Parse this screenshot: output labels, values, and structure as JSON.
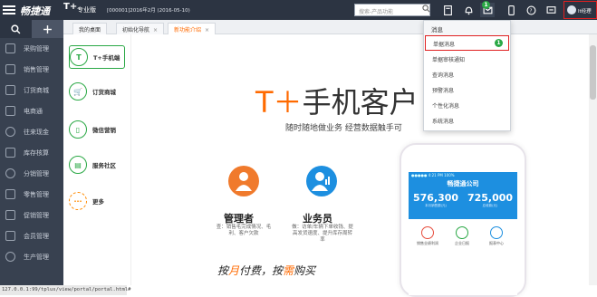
{
  "app": {
    "brand": "畅捷通",
    "brand_t": "T+",
    "edition": "专业版",
    "account": "[000001]2016年2月 (2016-05-10)",
    "search_placeholder": "搜索-产品功能",
    "user": "lt经理",
    "message_badge": "1"
  },
  "sidebar": {
    "items": [
      {
        "label": "采购管理",
        "icon": "cart-icon"
      },
      {
        "label": "销售管理",
        "icon": "sales-icon"
      },
      {
        "label": "订货商城",
        "icon": "mall-icon"
      },
      {
        "label": "电商通",
        "icon": "ecommerce-icon"
      },
      {
        "label": "往来现金",
        "icon": "cash-icon"
      },
      {
        "label": "库存核算",
        "icon": "inventory-icon"
      },
      {
        "label": "分销管理",
        "icon": "distribution-icon"
      },
      {
        "label": "零售管理",
        "icon": "retail-icon"
      },
      {
        "label": "促销管理",
        "icon": "promotion-icon"
      },
      {
        "label": "会员管理",
        "icon": "member-icon"
      },
      {
        "label": "生产管理",
        "icon": "production-icon"
      }
    ]
  },
  "tabs": [
    {
      "label": "我的桌面"
    },
    {
      "label": "初始化导航",
      "close": "×"
    },
    {
      "label": "新功能介绍",
      "close": "×"
    }
  ],
  "left_nav": [
    {
      "label": "T+手机端",
      "glyph": "T"
    },
    {
      "label": "订货商城",
      "glyph": "🛒"
    },
    {
      "label": "微信营销",
      "glyph": "▯"
    },
    {
      "label": "服务社区",
      "glyph": "▤"
    },
    {
      "label": "更多",
      "glyph": "···"
    }
  ],
  "hero": {
    "title_prefix": "T＋",
    "title_rest": "手机客户",
    "subtitle": "随时随地做业务    经营数据触手可"
  },
  "roles": [
    {
      "name": "管理者",
      "desc": "查：销售毛完成情况、毛利、客户欠款",
      "color": "#f07a2c"
    },
    {
      "name": "业务员",
      "desc": "做：访单/车辆下单收钱、提高发货速度、提升库存周转率",
      "color": "#1d8fe0"
    }
  ],
  "slogan": {
    "part1": "按",
    "o1": "月",
    "part2": "付费，按",
    "o2": "需",
    "part3": "购买"
  },
  "phone": {
    "status": "●●●●● 4:21 PM 100%",
    "title": "畅捷通公司",
    "num1": "576,300",
    "lab1": "本月销售额(元)",
    "num2": "725,000",
    "lab2": "应收款(元)",
    "grid": [
      "销售业绩利润",
      "企业日报",
      "报表中心",
      "",
      "",
      ""
    ]
  },
  "dropdown": {
    "header": "消息",
    "items": [
      "单据消息",
      "单据审核通知",
      "查询消息",
      "预警消息",
      "个性化消息",
      "系统消息"
    ],
    "selected_badge": "1"
  },
  "statusbar": "127.0.0.1:99/tplus/view/portal/portal.html#"
}
